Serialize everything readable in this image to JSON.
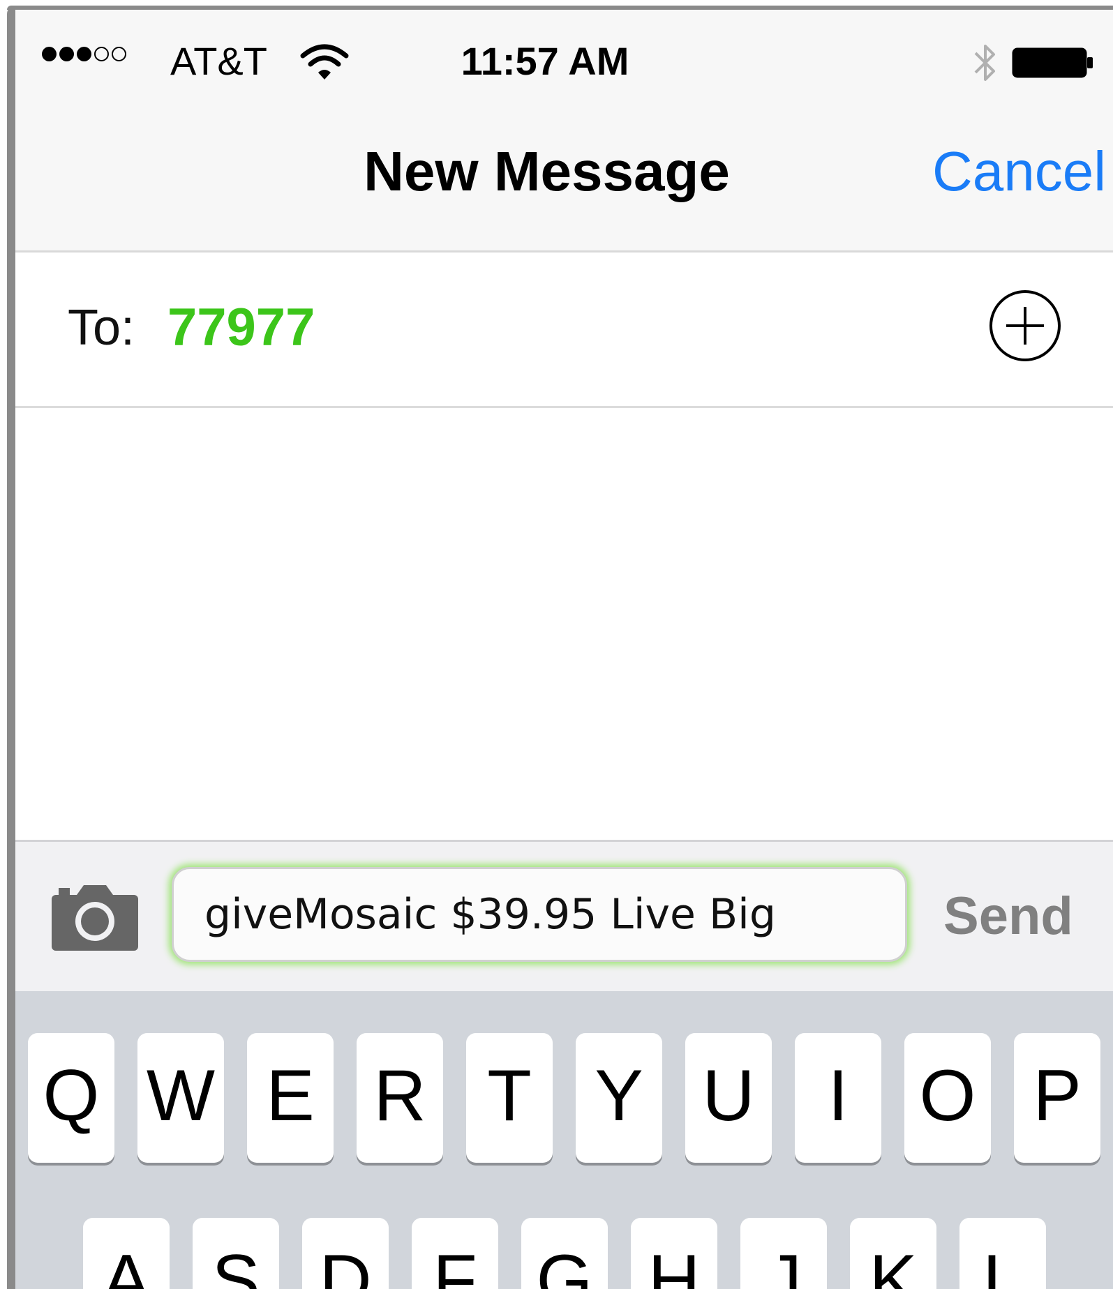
{
  "status_bar": {
    "signal_bars_filled": 3,
    "signal_bars_total": 5,
    "carrier": "AT&T",
    "time": "11:57 AM"
  },
  "nav": {
    "title": "New Message",
    "cancel_label": "Cancel"
  },
  "recipient": {
    "label": "To:",
    "value": "77977"
  },
  "composer": {
    "message_text": "giveMosaic $39.95 Live Big",
    "send_label": "Send"
  },
  "keyboard": {
    "row1": [
      "Q",
      "W",
      "E",
      "R",
      "T",
      "Y",
      "U",
      "I",
      "O",
      "P"
    ],
    "row2": [
      "A",
      "S",
      "D",
      "F",
      "G",
      "H",
      "J",
      "K",
      "L"
    ]
  },
  "colors": {
    "accent_blue": "#1a7cf7",
    "recipient_green": "#3cc51a",
    "send_gray": "#808080"
  },
  "icons": [
    "wifi-icon",
    "bluetooth-icon",
    "battery-icon",
    "add-contact-icon",
    "camera-icon"
  ]
}
